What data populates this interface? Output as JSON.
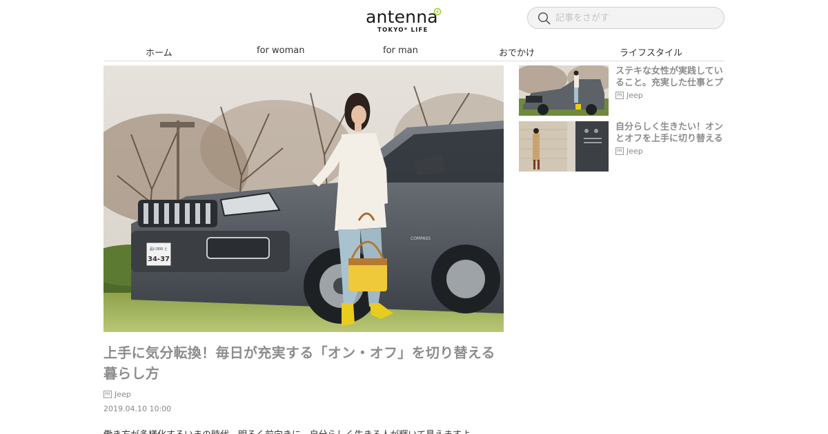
{
  "logo": {
    "word": "antenna",
    "sub": "TOKYO* LIFE"
  },
  "search": {
    "placeholder": "記事をさがす"
  },
  "nav": [
    {
      "label": "ホーム"
    },
    {
      "label": "for woman"
    },
    {
      "label": "for man"
    },
    {
      "label": "おでかけ"
    },
    {
      "label": "ライフスタイル"
    }
  ],
  "hero": {
    "plate_top": "品川300 と",
    "plate_num": "34-37",
    "brand_badge": "COMPASS"
  },
  "article": {
    "title": "上手に気分転換！毎日が充実する「オン・オフ」を切り替える暮らし方",
    "pr": "PR",
    "sponsor": "Jeep",
    "date": "2019.04.10 10:00",
    "lead": "働き方が多様化するいまの時代、明るく前向きに、自分らしく生きる人が輝いて見えますよ。"
  },
  "sidebar": [
    {
      "title": "ステキな女性が実践していること。充実した仕事とプ",
      "pr": "PR",
      "sponsor": "Jeep"
    },
    {
      "title": "自分らしく生きたい！オンとオフを上手に切り替える",
      "pr": "PR",
      "sponsor": "Jeep"
    }
  ],
  "colors": {
    "title_gray": "#8c8c8c",
    "logo_accent": "#a8d23c",
    "car_gray": "#5c6168"
  }
}
